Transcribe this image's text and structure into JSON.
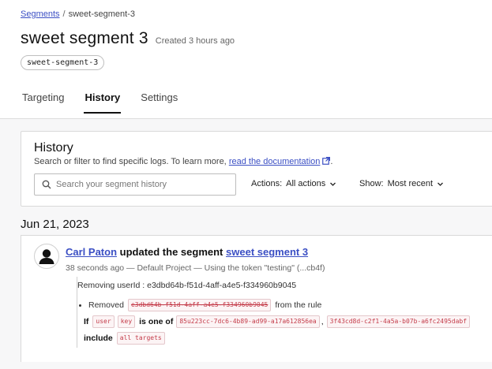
{
  "breadcrumb": {
    "root": "Segments",
    "separator": "/",
    "current": "sweet-segment-3"
  },
  "header": {
    "title": "sweet segment 3",
    "created": "Created 3 hours ago",
    "key": "sweet-segment-3"
  },
  "tabs": [
    {
      "label": "Targeting",
      "active": false
    },
    {
      "label": "History",
      "active": true
    },
    {
      "label": "Settings",
      "active": false
    }
  ],
  "history": {
    "title": "History",
    "description": "Search or filter to find specific logs. To learn more,",
    "doc_link": "read the documentation",
    "description_end": ".",
    "search": {
      "placeholder": "Search your segment history",
      "value": ""
    },
    "actions_filter": {
      "label": "Actions:",
      "value": "All actions"
    },
    "sort_filter": {
      "label": "Show:",
      "value": "Most recent"
    }
  },
  "log": {
    "date": "Jun 21, 2023",
    "entries": [
      {
        "user": "Carl Paton",
        "action": "updated the segment",
        "target": "sweet segment 3",
        "meta": "38 seconds ago — Default Project — Using the token \"testing\" (...cb4f)",
        "summary": "Removing userId : e3dbd64b-f51d-4aff-a4e5-f334960b9045",
        "bullet": {
          "prefix": "Removed",
          "value": "e3dbd64b-f51d-4aff-a4e5-f334960b9045",
          "suffix": "from the rule"
        },
        "rule": {
          "if": "If",
          "attr_kind": "user",
          "attr": "key",
          "op": "is one of",
          "values": [
            "85u223cc-7dc6-4b89-ad99-a17a612856ea",
            "3f43cd8d-c2f1-4a5a-b07b-a6fc2495dabf"
          ],
          "separator": ",",
          "include": "include",
          "include_value": "all targets"
        }
      }
    ]
  },
  "colors": {
    "link": "#3b4fc4",
    "code_text": "#c43c4a",
    "code_bg": "#fcf4f5",
    "page_bg": "#f7f7f8"
  },
  "icons": [
    "external-link-icon",
    "search-icon",
    "chevron-down-icon",
    "user-avatar-icon"
  ]
}
